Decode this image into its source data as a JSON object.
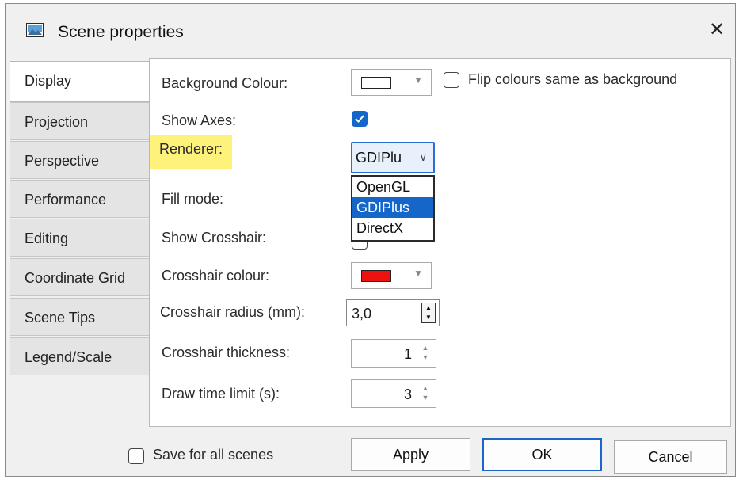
{
  "window": {
    "title": "Scene properties",
    "close_glyph": "✕"
  },
  "tabs": [
    "Display",
    "Projection",
    "Perspective",
    "Performance",
    "Editing",
    "Coordinate Grid",
    "Scene Tips",
    "Legend/Scale"
  ],
  "display": {
    "background_colour_label": "Background Colour:",
    "flip_colours_label": "Flip colours same as background",
    "show_axes_label": "Show Axes:",
    "renderer_label": "Renderer:",
    "renderer_value": "GDIPlu",
    "renderer_options": [
      "OpenGL",
      "GDIPlus",
      "DirectX"
    ],
    "fill_mode_label": "Fill mode:",
    "show_crosshair_label": "Show Crosshair:",
    "crosshair_colour_label": "Crosshair colour:",
    "crosshair_radius_label": "Crosshair radius (mm):",
    "crosshair_radius_value": "3,0",
    "crosshair_thickness_label": "Crosshair thickness:",
    "crosshair_thickness_value": "1",
    "draw_time_label": "Draw time limit (s):",
    "draw_time_value": "3"
  },
  "footer": {
    "save_all_label": "Save for all scenes",
    "apply_label": "Apply",
    "ok_label": "OK",
    "cancel_label": "Cancel"
  },
  "colors": {
    "accent": "#1467c8",
    "highlight": "#fff27a",
    "crosshair": "#ee1111"
  }
}
